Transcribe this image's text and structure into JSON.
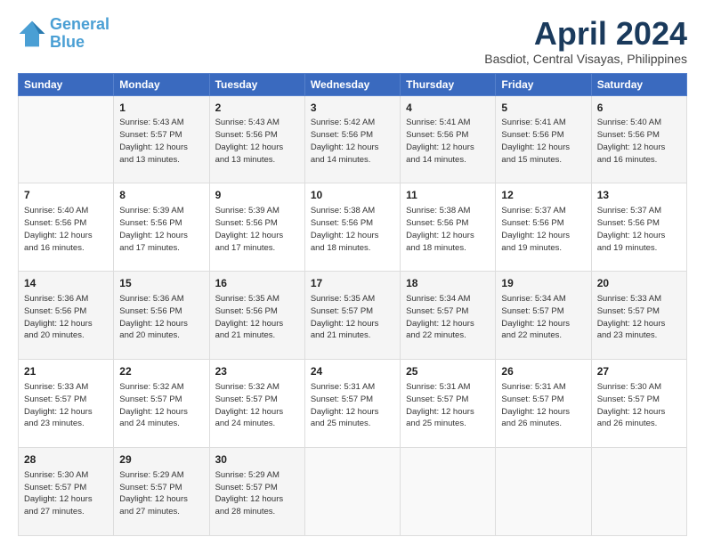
{
  "logo": {
    "line1": "General",
    "line2": "Blue"
  },
  "title": "April 2024",
  "subtitle": "Basdiot, Central Visayas, Philippines",
  "days": [
    "Sunday",
    "Monday",
    "Tuesday",
    "Wednesday",
    "Thursday",
    "Friday",
    "Saturday"
  ],
  "weeks": [
    [
      {
        "day": "",
        "sunrise": "",
        "sunset": "",
        "daylight": ""
      },
      {
        "day": "1",
        "sunrise": "Sunrise: 5:43 AM",
        "sunset": "Sunset: 5:57 PM",
        "daylight": "Daylight: 12 hours and 13 minutes."
      },
      {
        "day": "2",
        "sunrise": "Sunrise: 5:43 AM",
        "sunset": "Sunset: 5:56 PM",
        "daylight": "Daylight: 12 hours and 13 minutes."
      },
      {
        "day": "3",
        "sunrise": "Sunrise: 5:42 AM",
        "sunset": "Sunset: 5:56 PM",
        "daylight": "Daylight: 12 hours and 14 minutes."
      },
      {
        "day": "4",
        "sunrise": "Sunrise: 5:41 AM",
        "sunset": "Sunset: 5:56 PM",
        "daylight": "Daylight: 12 hours and 14 minutes."
      },
      {
        "day": "5",
        "sunrise": "Sunrise: 5:41 AM",
        "sunset": "Sunset: 5:56 PM",
        "daylight": "Daylight: 12 hours and 15 minutes."
      },
      {
        "day": "6",
        "sunrise": "Sunrise: 5:40 AM",
        "sunset": "Sunset: 5:56 PM",
        "daylight": "Daylight: 12 hours and 16 minutes."
      }
    ],
    [
      {
        "day": "7",
        "sunrise": "Sunrise: 5:40 AM",
        "sunset": "Sunset: 5:56 PM",
        "daylight": "Daylight: 12 hours and 16 minutes."
      },
      {
        "day": "8",
        "sunrise": "Sunrise: 5:39 AM",
        "sunset": "Sunset: 5:56 PM",
        "daylight": "Daylight: 12 hours and 17 minutes."
      },
      {
        "day": "9",
        "sunrise": "Sunrise: 5:39 AM",
        "sunset": "Sunset: 5:56 PM",
        "daylight": "Daylight: 12 hours and 17 minutes."
      },
      {
        "day": "10",
        "sunrise": "Sunrise: 5:38 AM",
        "sunset": "Sunset: 5:56 PM",
        "daylight": "Daylight: 12 hours and 18 minutes."
      },
      {
        "day": "11",
        "sunrise": "Sunrise: 5:38 AM",
        "sunset": "Sunset: 5:56 PM",
        "daylight": "Daylight: 12 hours and 18 minutes."
      },
      {
        "day": "12",
        "sunrise": "Sunrise: 5:37 AM",
        "sunset": "Sunset: 5:56 PM",
        "daylight": "Daylight: 12 hours and 19 minutes."
      },
      {
        "day": "13",
        "sunrise": "Sunrise: 5:37 AM",
        "sunset": "Sunset: 5:56 PM",
        "daylight": "Daylight: 12 hours and 19 minutes."
      }
    ],
    [
      {
        "day": "14",
        "sunrise": "Sunrise: 5:36 AM",
        "sunset": "Sunset: 5:56 PM",
        "daylight": "Daylight: 12 hours and 20 minutes."
      },
      {
        "day": "15",
        "sunrise": "Sunrise: 5:36 AM",
        "sunset": "Sunset: 5:56 PM",
        "daylight": "Daylight: 12 hours and 20 minutes."
      },
      {
        "day": "16",
        "sunrise": "Sunrise: 5:35 AM",
        "sunset": "Sunset: 5:56 PM",
        "daylight": "Daylight: 12 hours and 21 minutes."
      },
      {
        "day": "17",
        "sunrise": "Sunrise: 5:35 AM",
        "sunset": "Sunset: 5:57 PM",
        "daylight": "Daylight: 12 hours and 21 minutes."
      },
      {
        "day": "18",
        "sunrise": "Sunrise: 5:34 AM",
        "sunset": "Sunset: 5:57 PM",
        "daylight": "Daylight: 12 hours and 22 minutes."
      },
      {
        "day": "19",
        "sunrise": "Sunrise: 5:34 AM",
        "sunset": "Sunset: 5:57 PM",
        "daylight": "Daylight: 12 hours and 22 minutes."
      },
      {
        "day": "20",
        "sunrise": "Sunrise: 5:33 AM",
        "sunset": "Sunset: 5:57 PM",
        "daylight": "Daylight: 12 hours and 23 minutes."
      }
    ],
    [
      {
        "day": "21",
        "sunrise": "Sunrise: 5:33 AM",
        "sunset": "Sunset: 5:57 PM",
        "daylight": "Daylight: 12 hours and 23 minutes."
      },
      {
        "day": "22",
        "sunrise": "Sunrise: 5:32 AM",
        "sunset": "Sunset: 5:57 PM",
        "daylight": "Daylight: 12 hours and 24 minutes."
      },
      {
        "day": "23",
        "sunrise": "Sunrise: 5:32 AM",
        "sunset": "Sunset: 5:57 PM",
        "daylight": "Daylight: 12 hours and 24 minutes."
      },
      {
        "day": "24",
        "sunrise": "Sunrise: 5:31 AM",
        "sunset": "Sunset: 5:57 PM",
        "daylight": "Daylight: 12 hours and 25 minutes."
      },
      {
        "day": "25",
        "sunrise": "Sunrise: 5:31 AM",
        "sunset": "Sunset: 5:57 PM",
        "daylight": "Daylight: 12 hours and 25 minutes."
      },
      {
        "day": "26",
        "sunrise": "Sunrise: 5:31 AM",
        "sunset": "Sunset: 5:57 PM",
        "daylight": "Daylight: 12 hours and 26 minutes."
      },
      {
        "day": "27",
        "sunrise": "Sunrise: 5:30 AM",
        "sunset": "Sunset: 5:57 PM",
        "daylight": "Daylight: 12 hours and 26 minutes."
      }
    ],
    [
      {
        "day": "28",
        "sunrise": "Sunrise: 5:30 AM",
        "sunset": "Sunset: 5:57 PM",
        "daylight": "Daylight: 12 hours and 27 minutes."
      },
      {
        "day": "29",
        "sunrise": "Sunrise: 5:29 AM",
        "sunset": "Sunset: 5:57 PM",
        "daylight": "Daylight: 12 hours and 27 minutes."
      },
      {
        "day": "30",
        "sunrise": "Sunrise: 5:29 AM",
        "sunset": "Sunset: 5:57 PM",
        "daylight": "Daylight: 12 hours and 28 minutes."
      },
      {
        "day": "",
        "sunrise": "",
        "sunset": "",
        "daylight": ""
      },
      {
        "day": "",
        "sunrise": "",
        "sunset": "",
        "daylight": ""
      },
      {
        "day": "",
        "sunrise": "",
        "sunset": "",
        "daylight": ""
      },
      {
        "day": "",
        "sunrise": "",
        "sunset": "",
        "daylight": ""
      }
    ]
  ]
}
